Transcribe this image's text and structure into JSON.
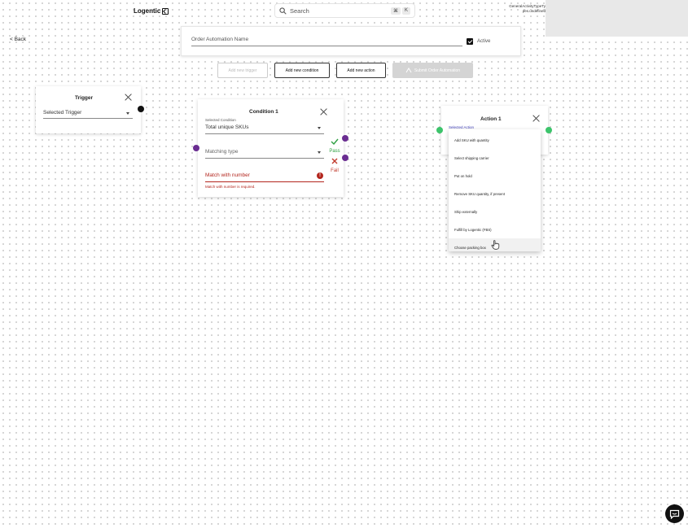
{
  "header": {
    "logo_text": "Logentic",
    "search_placeholder": "Search",
    "shortcut_cmd": "⌘",
    "shortcut_key": "K",
    "debug_text": "GeneralActivityTypeTypes.undefined"
  },
  "nav": {
    "back_label": "< Back"
  },
  "automation": {
    "name_placeholder": "Order Automation Name",
    "active_label": "Active",
    "active_checked": true
  },
  "toolbar": {
    "add_trigger": "Add new trigger",
    "add_condition": "Add new condition",
    "add_action": "Add new action",
    "submit": "Submit Order Automation"
  },
  "trigger": {
    "title": "Trigger",
    "select_placeholder": "Selected Trigger"
  },
  "condition": {
    "title": "Condition 1",
    "selected_label": "Selected Condition",
    "selected_value": "Total unique SKUs",
    "matching_placeholder": "Matching type",
    "match_number_placeholder": "Match with number",
    "error_text": "Match with number is required.",
    "pass_label": "Pass",
    "fail_label": "Fail"
  },
  "action": {
    "title": "Action 1",
    "selected_label": "Selected Action",
    "options": [
      "Add SKU with quantity",
      "Select shipping carrier",
      "Put on hold",
      "Remove SKU quantity, if present",
      "Ship externally",
      "Fulfill by Logentic (FBS)",
      "Choose packing box"
    ],
    "hovered_option": "Choose packing box"
  },
  "colors": {
    "pass": "#2ea043",
    "fail": "#c0392b",
    "error": "#b3261e",
    "port_purple": "#6a2d91",
    "port_green": "#3cc46b"
  }
}
